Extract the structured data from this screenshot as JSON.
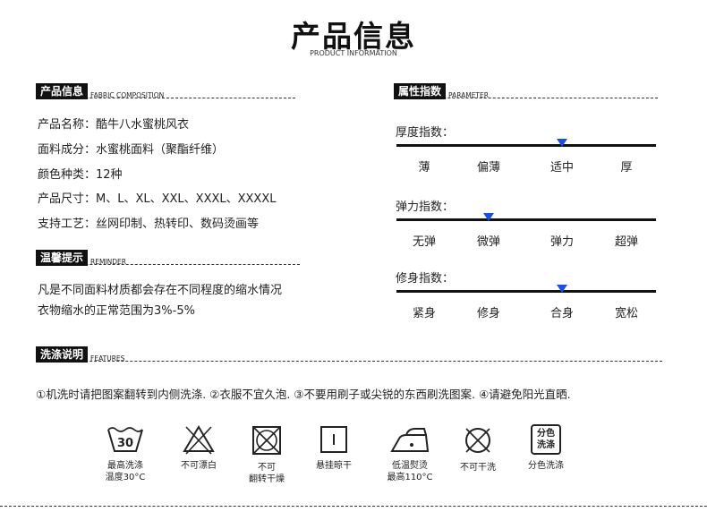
{
  "header": {
    "title": "产品信息",
    "subtitle": "PRODUCT INFORMATION"
  },
  "fabric": {
    "tag": "产品信息",
    "en": "FABRIC COMPOSITION",
    "lines": [
      "产品名称：酷牛八水蜜桃风衣",
      "面料成分：水蜜桃面料（聚酯纤维）",
      "颜色种类：12种",
      "产品尺寸：M、L、XL、XXL、XXXL、XXXXL",
      "支持工艺：丝网印制、热转印、数码烫画等"
    ]
  },
  "reminder": {
    "tag": "温馨提示",
    "en": "REMINDER",
    "lines": [
      "凡是不同面料材质都会存在不同程度的缩水情况",
      "衣物缩水的正常范围为3%-5%"
    ]
  },
  "parameter": {
    "tag": "属性指数",
    "en": "PARAMETER",
    "accent": "#1b4fe0",
    "scales": [
      {
        "label": "厚度指数：",
        "options": [
          "薄",
          "偏薄",
          "适中",
          "厚"
        ],
        "selected_index": 2
      },
      {
        "label": "弹力指数：",
        "options": [
          "无弹",
          "微弹",
          "弹力",
          "超弹"
        ],
        "selected_index": 1
      },
      {
        "label": "修身指数：",
        "options": [
          "紧身",
          "修身",
          "合身",
          "宽松"
        ],
        "selected_index": 2
      }
    ]
  },
  "features": {
    "tag": "洗涤说明",
    "en": "FEATURES",
    "text": "①机洗时请把图案翻转到内侧洗涤. ②衣服不宜久泡. ③不要用刷子或尖锐的东西刷洗图案. ④请避免阳光直晒.",
    "care": [
      {
        "icon": "wash-30-icon",
        "num": "30",
        "label": "最高洗涤\n温度30°C"
      },
      {
        "icon": "no-bleach-icon",
        "label": "不可漂白"
      },
      {
        "icon": "no-tumble-dry-icon",
        "label": "不可\n翻转干燥"
      },
      {
        "icon": "hang-dry-icon",
        "label": "悬挂晾干"
      },
      {
        "icon": "low-iron-icon",
        "label": "低温熨烫\n最高110°C"
      },
      {
        "icon": "no-dry-clean-icon",
        "label": "不可干洗"
      },
      {
        "icon": "separate-wash-icon",
        "glyph": "分色\n洗涤",
        "label": "分色洗涤"
      }
    ]
  }
}
